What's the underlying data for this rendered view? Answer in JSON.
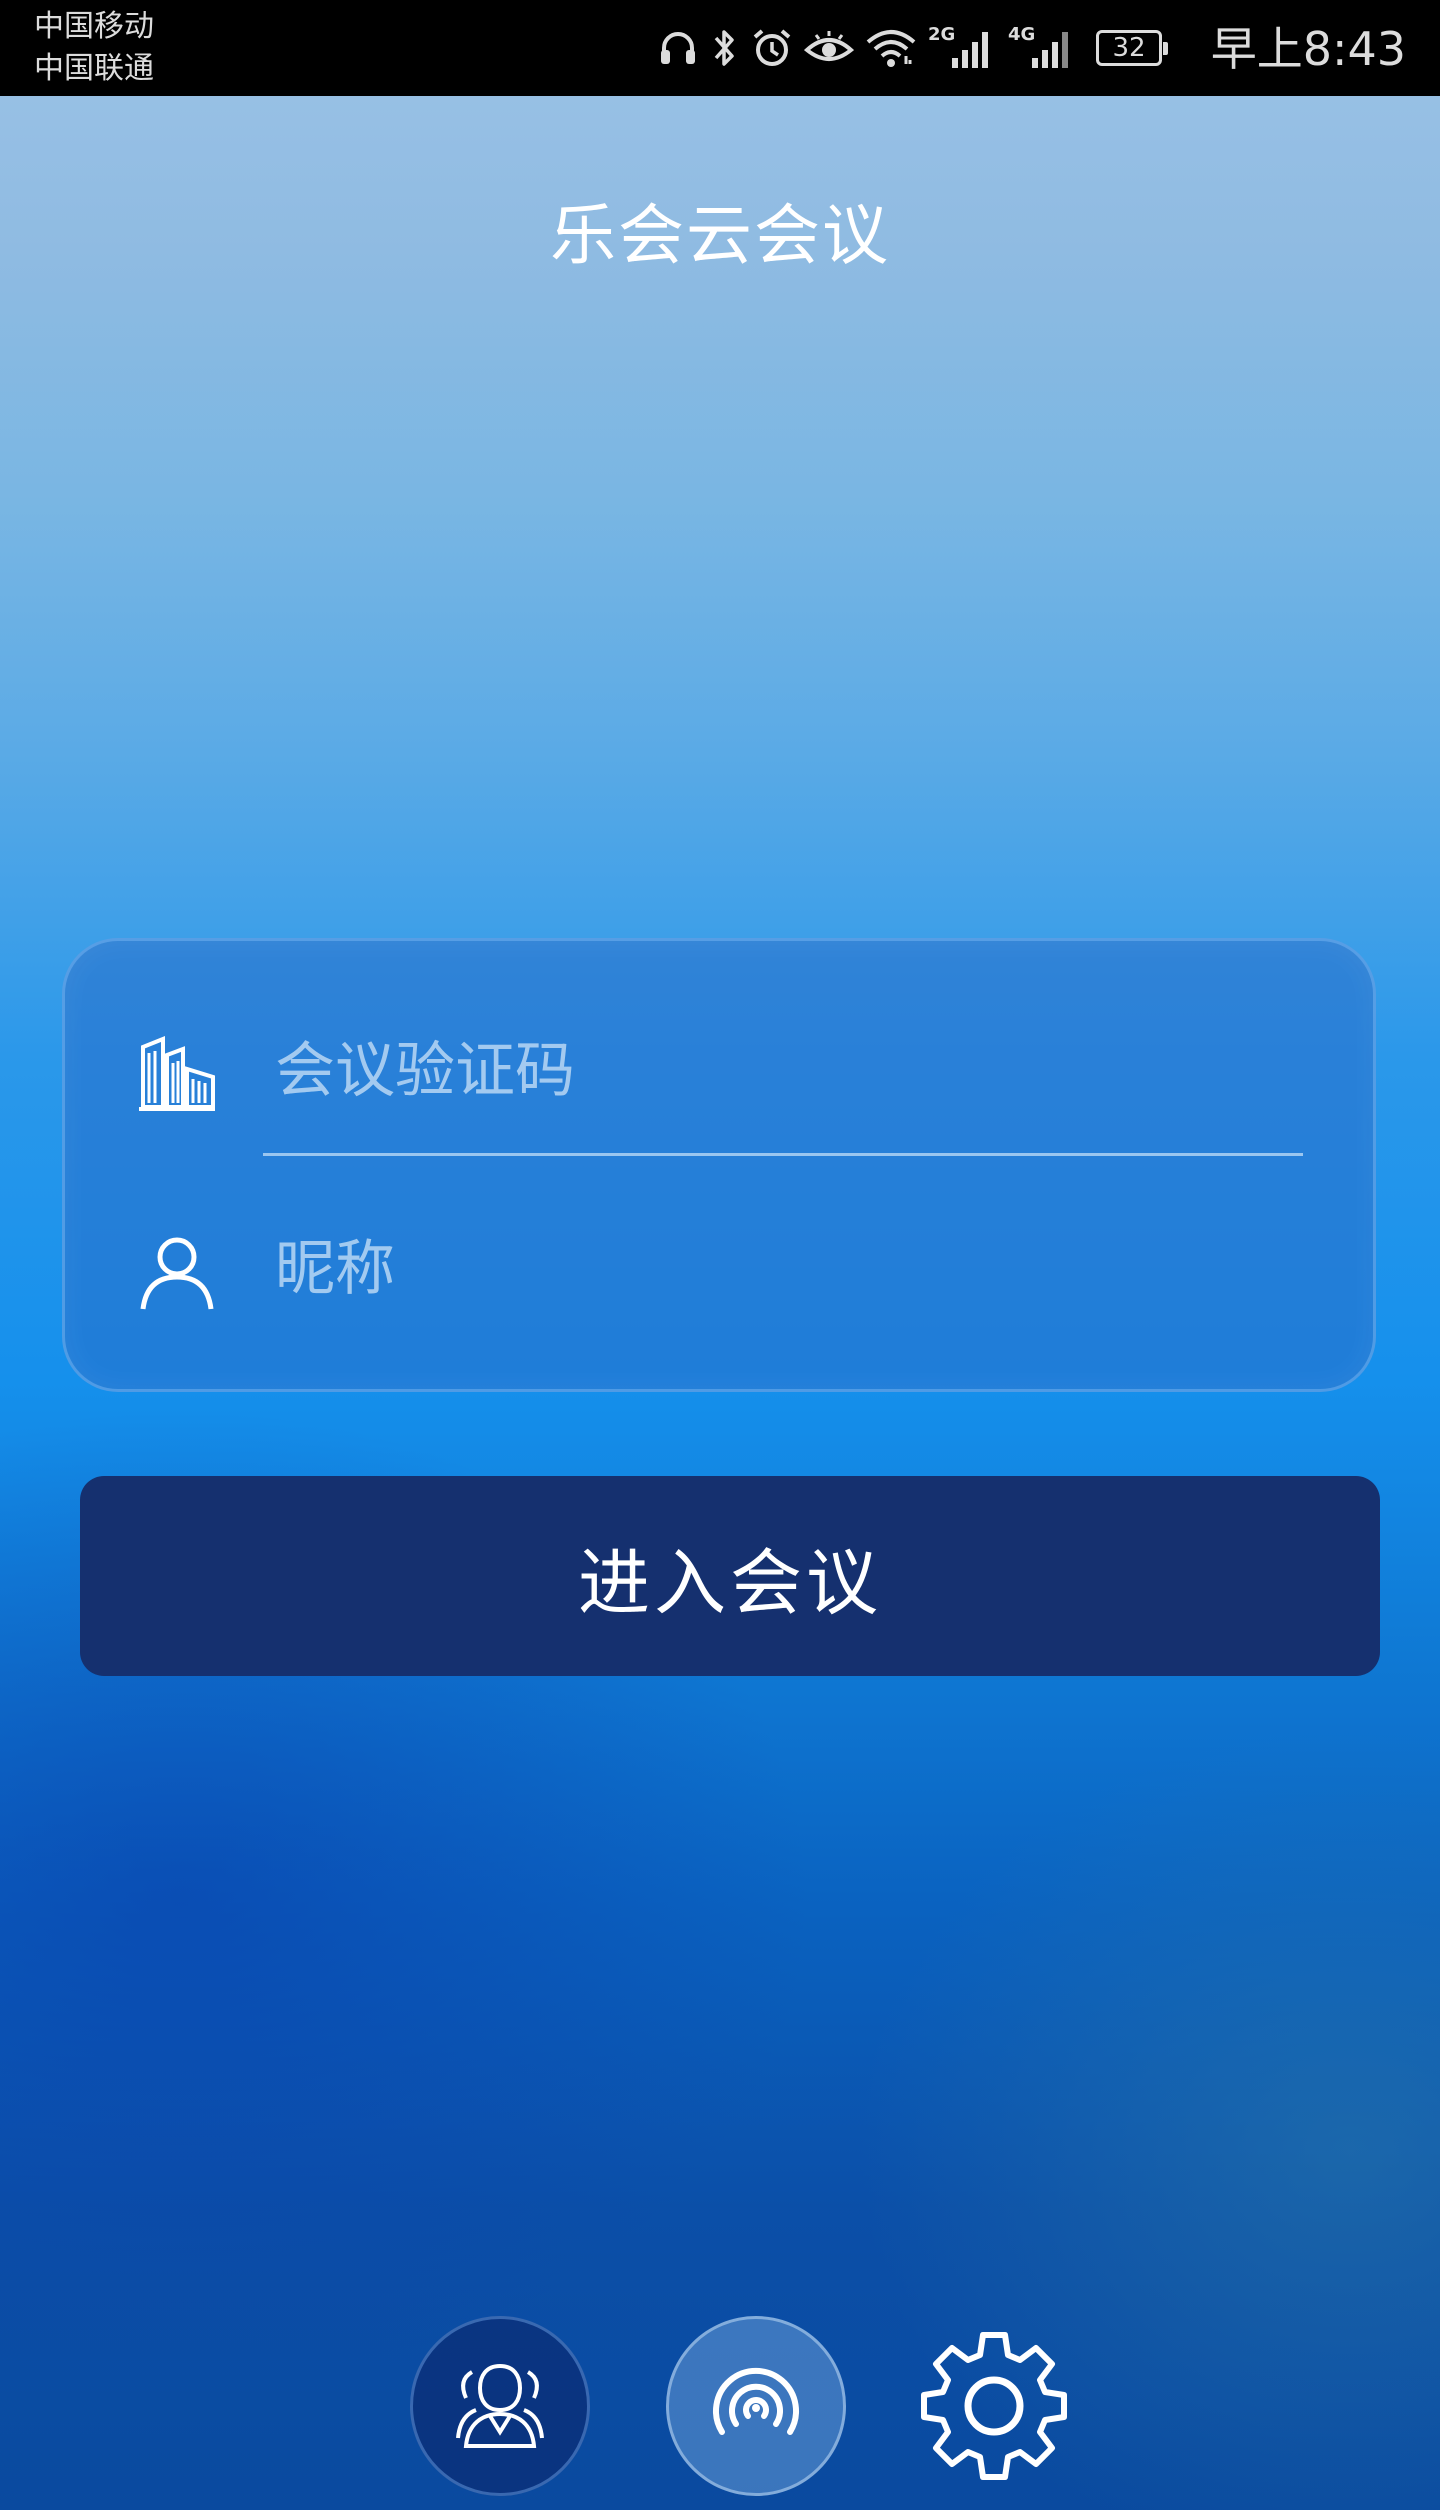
{
  "status_bar": {
    "carrier_1": "中国移动",
    "carrier_2": "中国联通",
    "network_1": "2G",
    "network_2": "4G",
    "battery": "32",
    "time": "早上8:43",
    "icons": [
      "headset-icon",
      "bluetooth-icon",
      "alarm-icon",
      "eye-comfort-icon",
      "wifi-icon",
      "signal-2g-icon",
      "signal-4g-icon",
      "battery-icon"
    ]
  },
  "header": {
    "title": "乐会云会议"
  },
  "login_form": {
    "meeting_code": {
      "placeholder": "会议验证码",
      "value": "",
      "icon": "building-icon"
    },
    "nickname": {
      "placeholder": "昵称",
      "value": "",
      "icon": "user-icon"
    }
  },
  "enter_button": {
    "label": "进入会议"
  },
  "bottom_nav": {
    "items": [
      {
        "icon": "contacts-icon"
      },
      {
        "icon": "signal-broadcast-icon"
      },
      {
        "icon": "settings-gear-icon"
      }
    ]
  },
  "colors": {
    "button_background": "#15306f",
    "text_primary": "#ffffff",
    "status_bar_background": "#000000"
  }
}
